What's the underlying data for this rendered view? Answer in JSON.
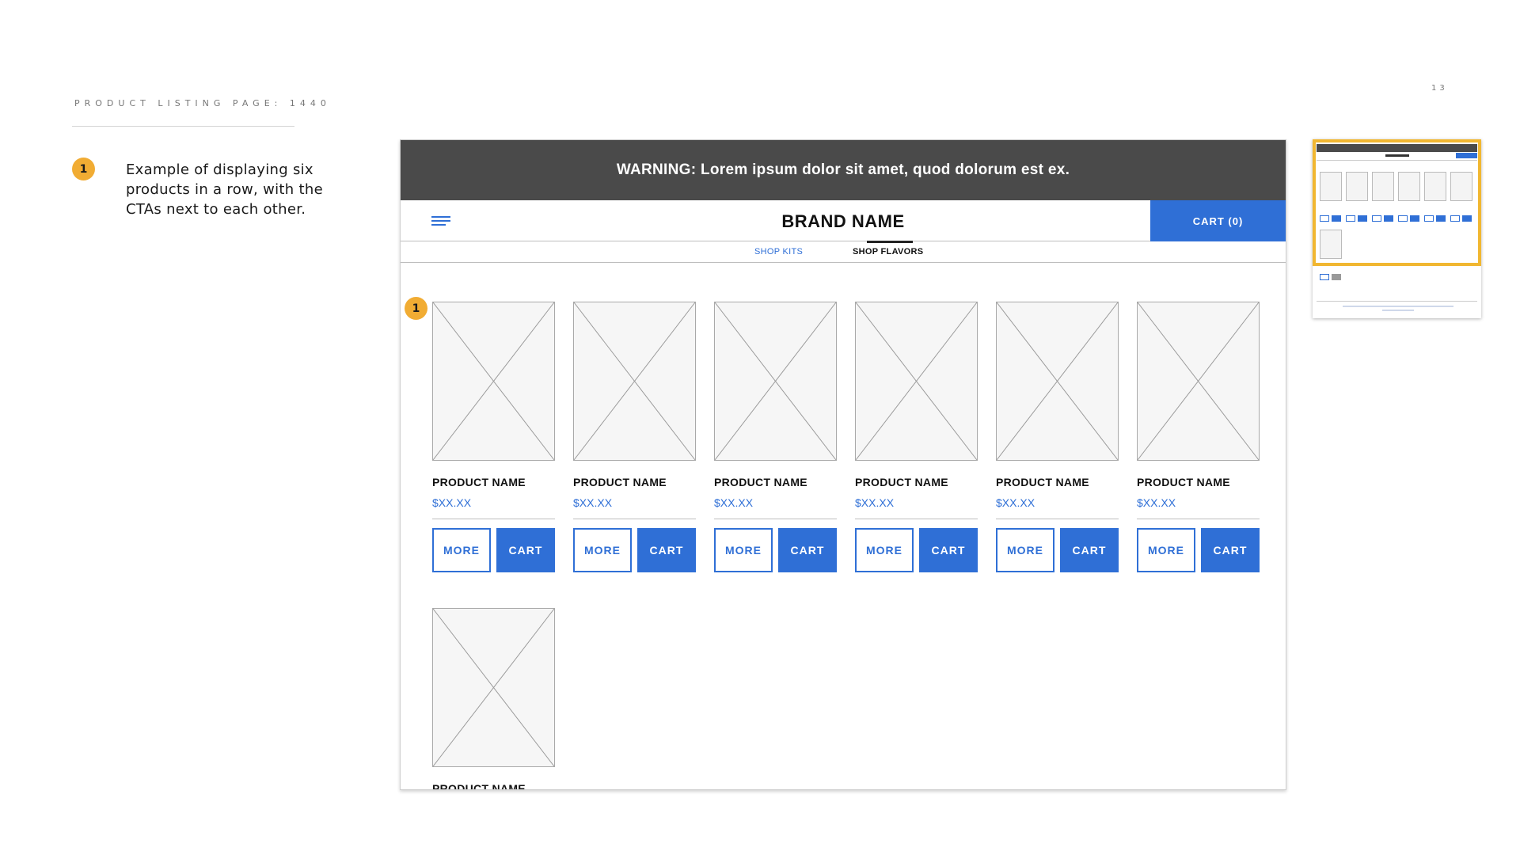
{
  "slide": {
    "title": "PRODUCT LISTING PAGE: 1440",
    "page_number": "13",
    "note_badge": "1",
    "note_text": "Example of displaying six products in a row, with the CTAs next to each other."
  },
  "wireframe": {
    "warning": "WARNING: Lorem ipsum dolor sit amet, quod dolorum est ex.",
    "brand": "BRAND NAME",
    "cart_label": "CART (0)",
    "menu_icon": "hamburger-menu-icon",
    "subnav": {
      "shop_kits": "SHOP KITS",
      "shop_flavors": "SHOP FLAVORS",
      "active": "SHOP FLAVORS"
    },
    "grid_badge": "1",
    "products": [
      {
        "name": "PRODUCT NAME",
        "price": "$XX.XX",
        "more": "MORE",
        "cart": "CART"
      },
      {
        "name": "PRODUCT NAME",
        "price": "$XX.XX",
        "more": "MORE",
        "cart": "CART"
      },
      {
        "name": "PRODUCT NAME",
        "price": "$XX.XX",
        "more": "MORE",
        "cart": "CART"
      },
      {
        "name": "PRODUCT NAME",
        "price": "$XX.XX",
        "more": "MORE",
        "cart": "CART"
      },
      {
        "name": "PRODUCT NAME",
        "price": "$XX.XX",
        "more": "MORE",
        "cart": "CART"
      },
      {
        "name": "PRODUCT NAME",
        "price": "$XX.XX",
        "more": "MORE",
        "cart": "CART"
      },
      {
        "name": "PRODUCT NAME"
      }
    ]
  },
  "colors": {
    "accent": "#2f6fd6",
    "badge": "#f1ac33",
    "warning_bg": "#4a4a4a",
    "thumbnail_highlight": "#f1b731"
  }
}
